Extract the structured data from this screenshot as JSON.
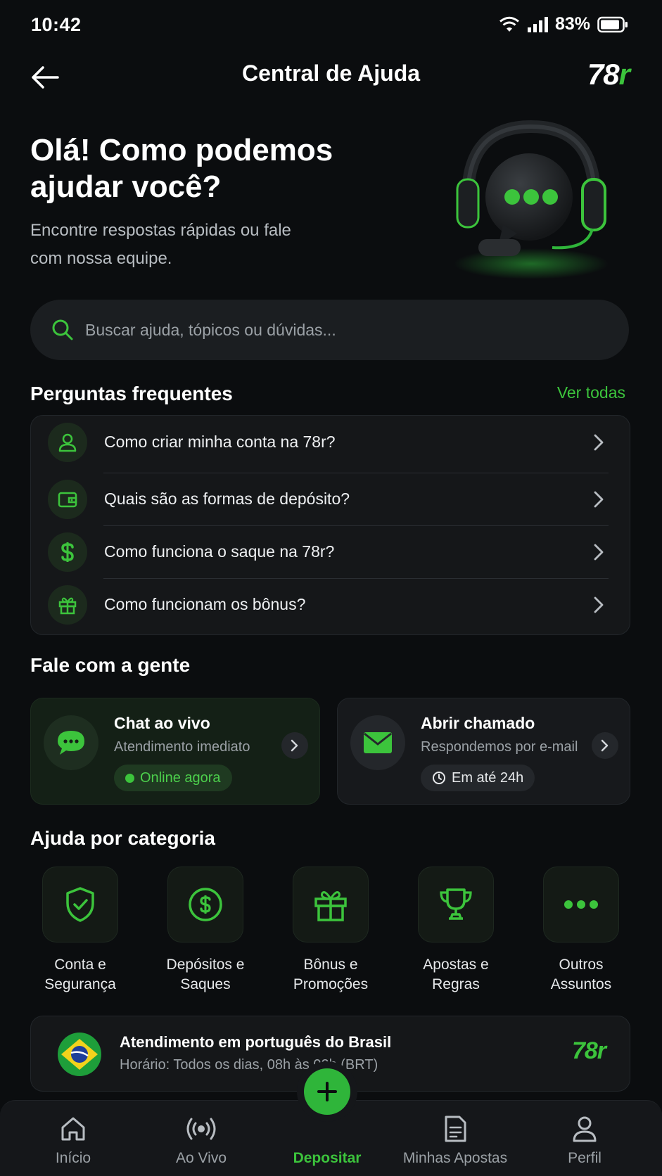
{
  "status_bar": {
    "time": "10:42",
    "battery_pct": "83%"
  },
  "header": {
    "title": "Central de Ajuda",
    "logo_main": "78",
    "logo_r": "r"
  },
  "hero": {
    "title": "Olá! Como podemos ajudar você?",
    "subtitle": "Encontre respostas rápidas ou fale com nossa equipe."
  },
  "search": {
    "placeholder": "Buscar ajuda, tópicos ou dúvidas..."
  },
  "faq": {
    "title": "Perguntas frequentes",
    "see_all": "Ver todas",
    "items": [
      {
        "label": "Como criar minha conta na 78r?",
        "icon": "user-icon"
      },
      {
        "label": "Quais são as formas de depósito?",
        "icon": "wallet-icon"
      },
      {
        "label": "Como funciona o saque na 78r?",
        "icon": "dollar-icon"
      },
      {
        "label": "Como funcionam os bônus?",
        "icon": "gift-icon"
      }
    ]
  },
  "contact": {
    "title": "Fale com a gente",
    "chat": {
      "title": "Chat ao vivo",
      "subtitle": "Atendimento imediato",
      "status": "Online agora"
    },
    "ticket": {
      "title": "Abrir chamado",
      "subtitle": "Respondemos por e-mail",
      "eta": "Em até 24h"
    }
  },
  "categories": {
    "title": "Ajuda por categoria",
    "items": [
      {
        "label": "Conta e\nSegurança",
        "icon": "shield-check-icon"
      },
      {
        "label": "Depósitos e\nSaques",
        "icon": "dollar-circle-icon"
      },
      {
        "label": "Bônus e\nPromoções",
        "icon": "gift-icon"
      },
      {
        "label": "Apostas e\nRegras",
        "icon": "trophy-icon"
      },
      {
        "label": "Outros\nAssuntos",
        "icon": "more-dots-icon"
      }
    ]
  },
  "banner": {
    "title": "Atendimento em português do Brasil",
    "subtitle": "Horário: Todos os dias, 08h às 02h (BRT)",
    "logo": "78r"
  },
  "nav": {
    "items": [
      {
        "label": "Início",
        "icon": "home-icon"
      },
      {
        "label": "Ao Vivo",
        "icon": "live-broadcast-icon"
      },
      {
        "label": "Depositar",
        "icon": "plus-icon"
      },
      {
        "label": "Minhas Apostas",
        "icon": "document-icon"
      },
      {
        "label": "Perfil",
        "icon": "user-icon"
      }
    ]
  },
  "colors": {
    "accent": "#3cc43c",
    "background": "#0b0d0f",
    "card": "#151719"
  }
}
